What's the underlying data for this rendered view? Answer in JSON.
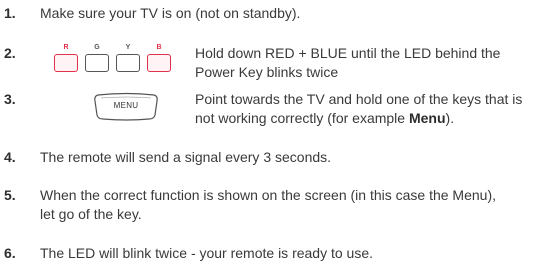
{
  "steps": [
    {
      "number": "1.",
      "text": "Make sure your TV is on (not on standby)."
    },
    {
      "number": "2.",
      "line1": "Hold down RED + BLUE until the LED behind the",
      "line2": "Power Key blinks twice"
    },
    {
      "number": "3.",
      "line1": "Point towards the TV and hold one of the keys that is",
      "line2_plain": "not working correctly (for example ",
      "line2_bold": "Menu",
      "line2_end": ")."
    },
    {
      "number": "4.",
      "text": "The remote will send a signal every 3 seconds."
    },
    {
      "number": "5.",
      "line1": "When the correct function is shown on the screen (in this case the Menu),",
      "line2": "let go of the key."
    },
    {
      "number": "6.",
      "text": "The LED will blink twice - your remote is ready to use."
    }
  ],
  "color_keys": [
    {
      "label": "R",
      "color": "#e0314b",
      "highlighted": true
    },
    {
      "label": "G",
      "color": "#555555",
      "highlighted": false
    },
    {
      "label": "Y",
      "color": "#555555",
      "highlighted": false
    },
    {
      "label": "B",
      "color": "#e0314b",
      "highlighted": true
    }
  ],
  "menu_key": {
    "label": "MENU"
  }
}
